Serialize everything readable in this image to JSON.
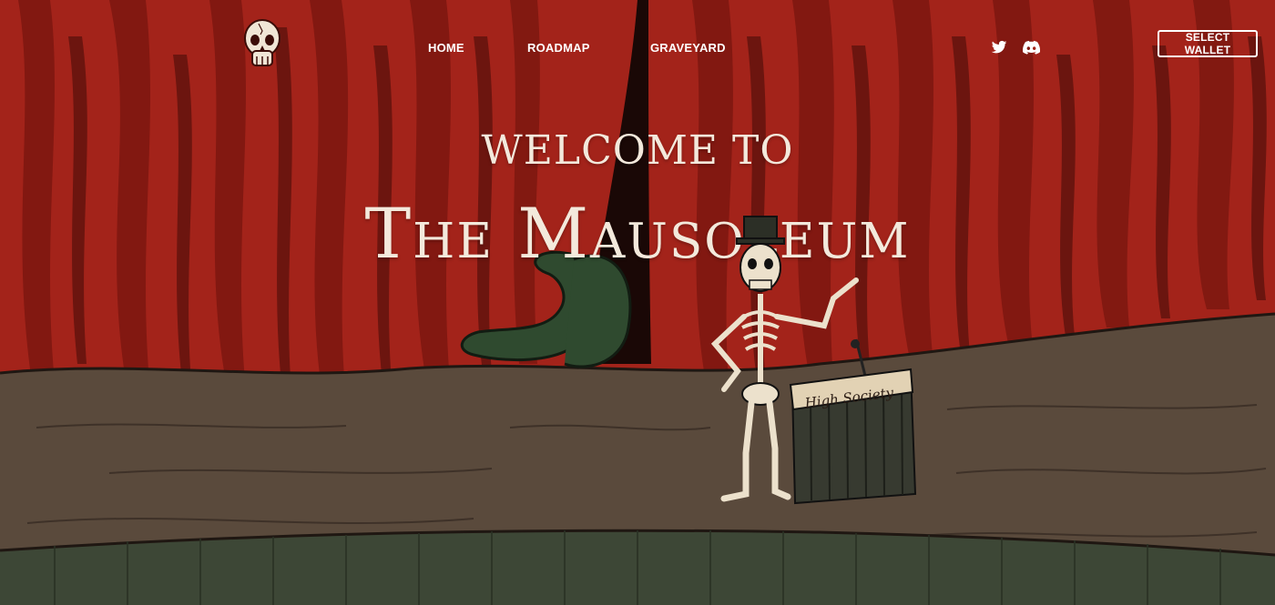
{
  "nav": {
    "logo_icon": "skull-logo-icon",
    "items": [
      {
        "label": "HOME"
      },
      {
        "label": "ROADMAP"
      },
      {
        "label": "GRAVEYARD"
      }
    ],
    "social": [
      {
        "icon": "twitter-icon"
      },
      {
        "icon": "discord-icon"
      }
    ],
    "wallet_button": "SELECT WALLET"
  },
  "hero": {
    "line1": "WELCOME TO",
    "line2": "The Mausoleum"
  },
  "illustration": {
    "podium_sign": "High Society",
    "character_icon": "skeleton-host-icon"
  },
  "colors": {
    "curtain": "#a3231a",
    "curtain_dark": "#5e120d",
    "stage": "#5a4a3c",
    "text": "#f3e9dc"
  }
}
